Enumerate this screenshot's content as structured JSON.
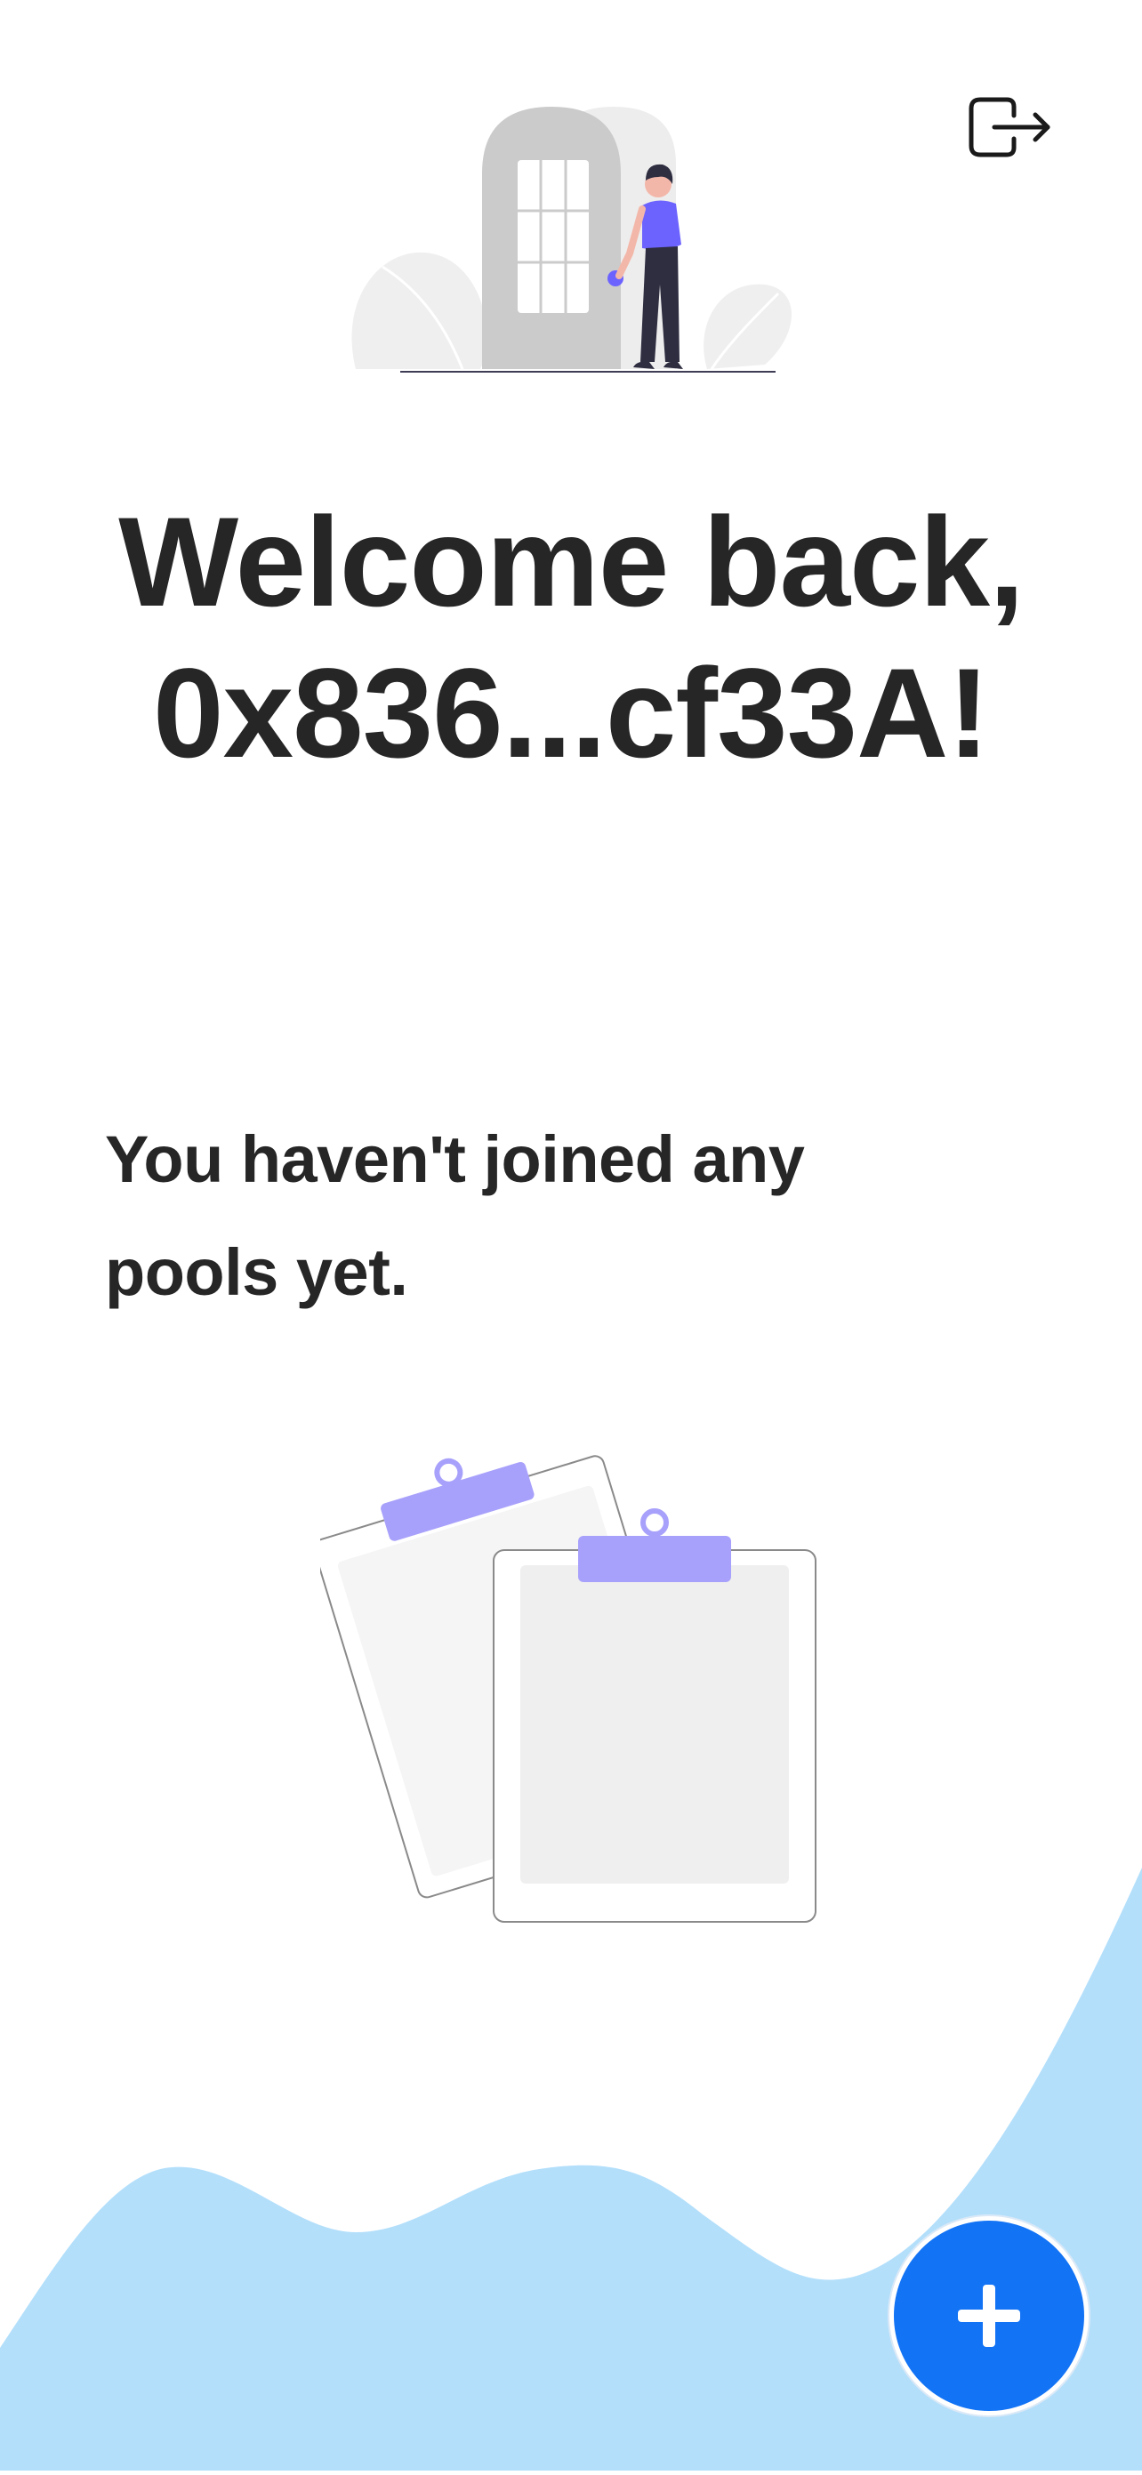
{
  "header": {
    "logout_icon": "logout-icon"
  },
  "welcome": {
    "line1": "Welcome back,",
    "line2": "0x836...cf33A!"
  },
  "empty_state": {
    "line1": "You haven't joined any",
    "line2": "pools yet."
  },
  "fab": {
    "icon": "plus-icon"
  },
  "colors": {
    "accent": "#6c63ff",
    "clip_purple": "#a8a1fb",
    "wave": "#b3dffb",
    "fab": "#1273f5",
    "text": "#262626"
  }
}
